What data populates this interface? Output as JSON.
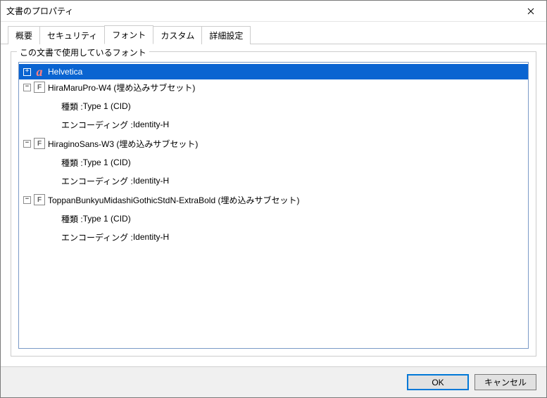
{
  "window": {
    "title": "文書のプロパティ"
  },
  "tabs": {
    "overview": "概要",
    "security": "セキュリティ",
    "fonts": "フォント",
    "custom": "カスタム",
    "advanced": "詳細設定"
  },
  "group": {
    "legend": "この文書で使用しているフォント"
  },
  "fonts_tree": {
    "expand_plus": "+",
    "expand_minus": "−",
    "f_glyph": "F",
    "a_glyph": "a",
    "type_prefix": "種類 : ",
    "encoding_prefix": "エンコーディング : ",
    "items": [
      {
        "name": "Helvetica",
        "expanded": false,
        "selected": true,
        "icon": "red"
      },
      {
        "name": "HiraMaruPro-W4 (埋め込みサブセット)",
        "expanded": true,
        "selected": false,
        "icon": "f",
        "type_value": "Type 1 (CID)",
        "encoding_value": "Identity-H"
      },
      {
        "name": "HiraginoSans-W3 (埋め込みサブセット)",
        "expanded": true,
        "selected": false,
        "icon": "f",
        "type_value": "Type 1 (CID)",
        "encoding_value": "Identity-H"
      },
      {
        "name": "ToppanBunkyuMidashiGothicStdN-ExtraBold (埋め込みサブセット)",
        "expanded": true,
        "selected": false,
        "icon": "f",
        "type_value": "Type 1 (CID)",
        "encoding_value": "Identity-H"
      }
    ]
  },
  "footer": {
    "ok": "OK",
    "cancel": "キャンセル"
  }
}
